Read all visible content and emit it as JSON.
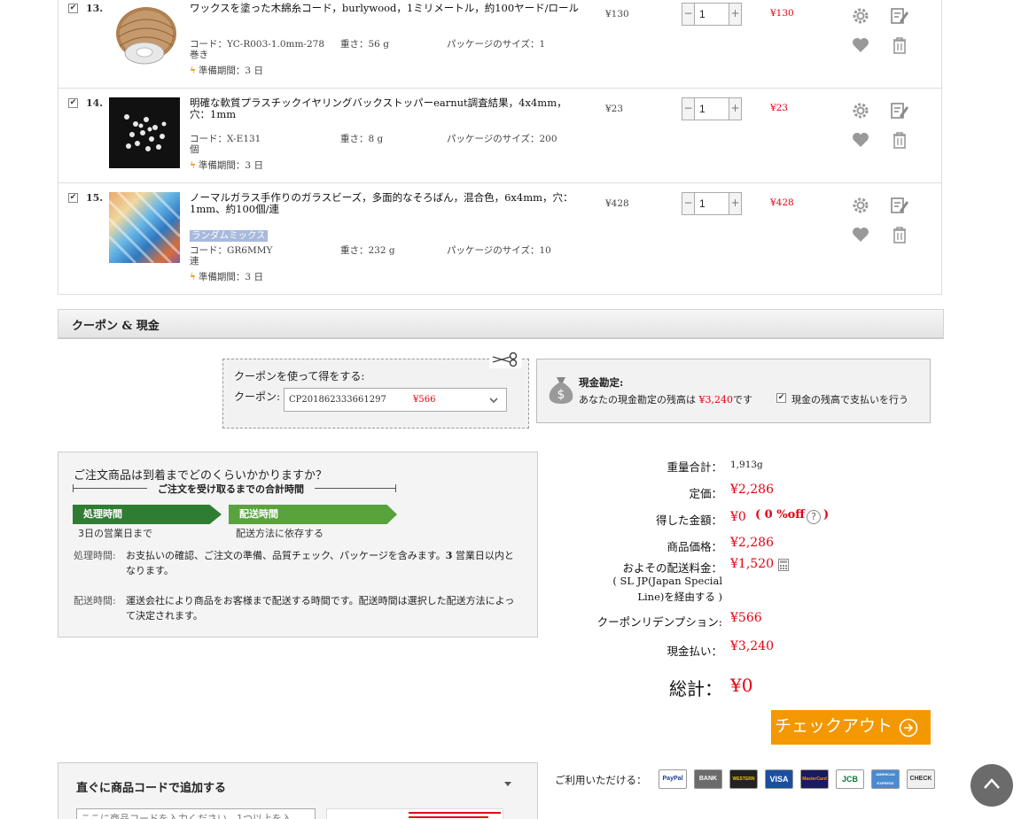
{
  "items": [
    {
      "index": "13.",
      "title": "ワックスを塗った木綿糸コード，burlywood，1ミリメートル，約100ヤード/ロール",
      "tag": "",
      "code_label": "コード：YC-R003-1.0mm-278",
      "weight_label": "重さ：56 g",
      "package_label": "パッケージのサイズ：1",
      "package_unit": "巻き",
      "lead_time": "準備期間：3 日",
      "price": "¥130",
      "quantity": "1",
      "subtotal": "¥130",
      "checked": true
    },
    {
      "index": "14.",
      "title": "明確な軟質プラスチックイヤリングバックストッパーearnut調査結果，4x4mm，穴：1mm",
      "tag": "",
      "code_label": "コード：X-E131",
      "weight_label": "重さ：8 g",
      "package_label": "パッケージのサイズ：200",
      "package_unit": "個",
      "lead_time": "準備期間：3 日",
      "price": "¥23",
      "quantity": "1",
      "subtotal": "¥23",
      "checked": true
    },
    {
      "index": "15.",
      "title": "ノーマルガラス手作りのガラスビーズ，多面的なそろばん，混合色，6x4mm，穴：1mm、約100個/連",
      "tag": "ランダムミックス",
      "code_label": "コード：GR6MMY",
      "weight_label": "重さ：232 g",
      "package_label": "パッケージのサイズ：10",
      "package_unit": "連",
      "lead_time": "準備期間：3 日",
      "price": "¥428",
      "quantity": "1",
      "subtotal": "¥428",
      "checked": true
    }
  ],
  "coupon": {
    "section_title": "クーポン & 現金",
    "prompt": "クーポンを使って得をする:",
    "field_label": "クーポン:",
    "selected_code": "CP201862333661297",
    "selected_amount": "¥566"
  },
  "cash": {
    "title": "現金勘定:",
    "balance_prefix": "あなたの現金勘定の残高は",
    "balance_amount": "¥3,240",
    "balance_suffix": "です",
    "pay_with_balance_label": "現金の残高で支払いを行う",
    "pay_with_balance_checked": true
  },
  "delivery": {
    "question": "ご注文商品は到着までどのくらいかかりますか？",
    "total_time_label": "ご注文を受け取るまでの合計時間",
    "processing_label": "処理時間",
    "processing_desc": "3日の営業日まで",
    "shipping_label": "配送時間",
    "shipping_desc": "配送方法に依存する",
    "processing_note_label": "処理時間:",
    "processing_note_a": "お支払いの確認、ご注文の準備、品質チェック、パッケージを含みます。",
    "processing_note_days": "3",
    "processing_note_b": "営業日以内となります。",
    "shipping_note_label": "配送時間:",
    "shipping_note": "運送会社により商品をお客様まで配送する時間です。配送時間は選択した配送方法によって決定されます。"
  },
  "summary": {
    "weight_label": "重量合計：",
    "weight_value": "1,913g",
    "list_price_label": "定価：",
    "list_price_value": "¥2,286",
    "saved_label": "得した金額：",
    "saved_value": "¥0",
    "saved_pct": "( 0 %off",
    "saved_close": ")",
    "product_price_label": "商品価格：",
    "product_price_value": "¥2,286",
    "shipping_label": "およその配送料金：",
    "shipping_value": "¥1,520",
    "shipping_via_1": "( SL JP(Japan Special",
    "shipping_via_2": "Line)を経由する )",
    "coupon_label": "クーポンリデンプション:",
    "coupon_value": "¥566",
    "cash_label": "現金払い：",
    "cash_value": "¥3,240",
    "total_label": "総計：",
    "total_value": "¥0",
    "checkout_label": "チェックアウト"
  },
  "add_by_code": {
    "title": "直ぐに商品コードで追加する",
    "placeholder": "ここに商品コードを入力ください。1つ以上を入"
  },
  "payments": {
    "label": "ご利用いただける：",
    "methods": [
      "PayPal",
      "BANK",
      "WESTERN UNION",
      "VISA",
      "MasterCard",
      "JCB",
      "AMERICAN EXPRESS",
      "CHECK"
    ]
  },
  "colors": {
    "price_red": "#e50012",
    "checkout_orange": "#f39800",
    "processing_green": "#2e7d32",
    "shipping_green": "#58a33c"
  }
}
